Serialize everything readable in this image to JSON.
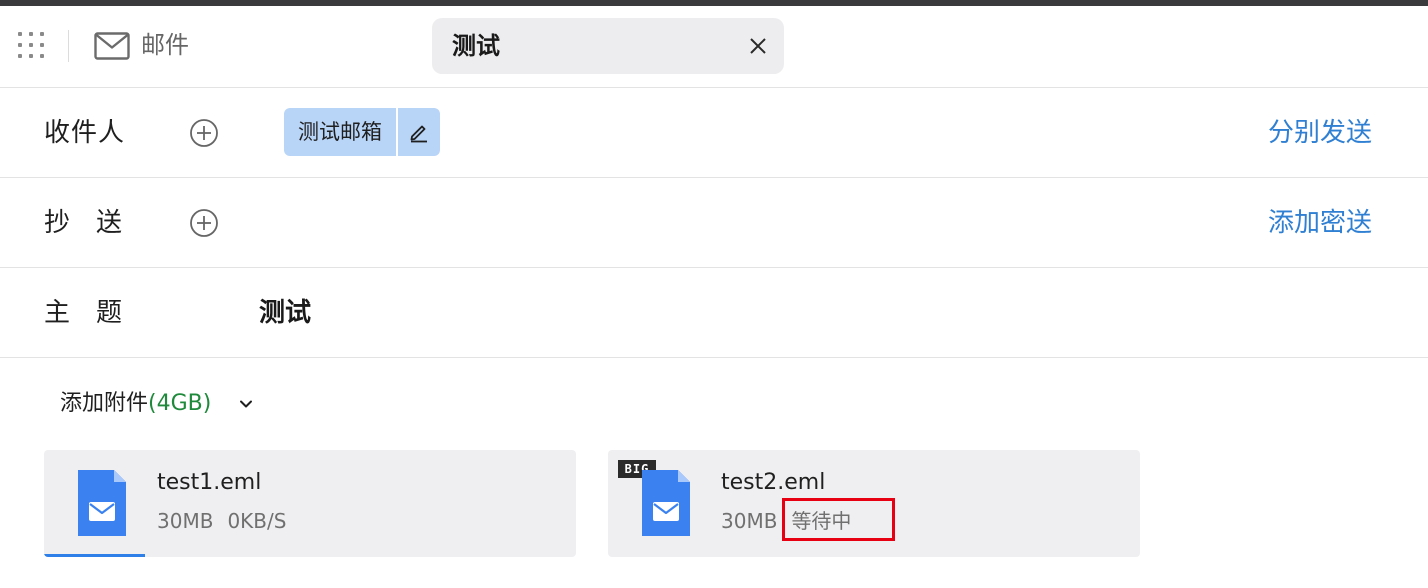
{
  "header": {
    "app_name": "邮件",
    "tab_title": "测试"
  },
  "recipients": {
    "label": "收件人",
    "chips": [
      {
        "label": "测试邮箱"
      }
    ],
    "link": "分别发送"
  },
  "cc": {
    "label": "抄送",
    "link": "添加密送"
  },
  "subject": {
    "label": "主题",
    "value": "测试"
  },
  "attachments": {
    "label": "添加附件",
    "quota": "(4GB)",
    "files": [
      {
        "name": "test1.eml",
        "size": "30MB",
        "status": "0KB/S",
        "progress": 0.19,
        "big": false
      },
      {
        "name": "test2.eml",
        "size": "30MB",
        "status": "等待中",
        "big": true,
        "big_badge": "BIG",
        "status_highlighted": true
      }
    ]
  },
  "colors": {
    "link": "#2f7fd3",
    "chip": "#b8d4f7",
    "file_icon": "#3b82f0",
    "quota": "#1f8a3b",
    "progress": "#2f7fe8",
    "highlight": "#e60012"
  },
  "icons": {
    "apps": "grid-icon",
    "mail": "mail-icon",
    "close": "close-icon",
    "add": "plus-circle-icon",
    "edit": "pencil-icon",
    "expand": "chevron-down-icon",
    "file": "mail-file-icon"
  }
}
